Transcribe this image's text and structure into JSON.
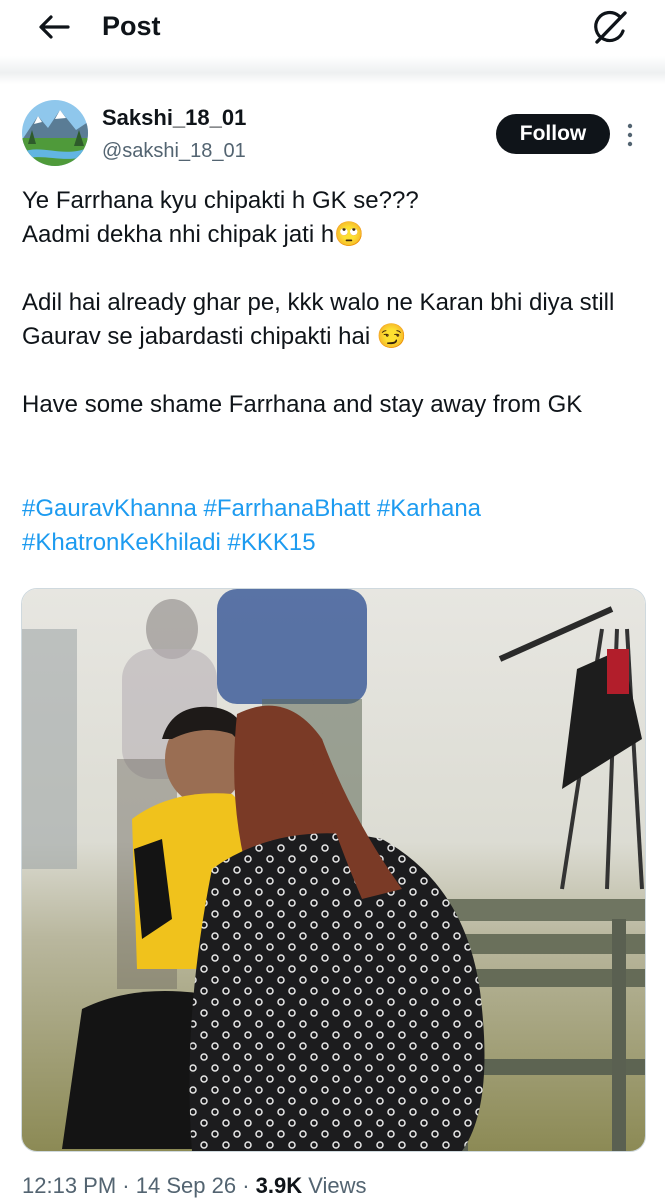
{
  "header": {
    "title": "Post",
    "back_icon": "back-arrow-icon",
    "grok_icon": "grok-icon"
  },
  "author": {
    "display_name": "Sakshi_18_01",
    "handle": "@sakshi_18_01",
    "follow_label": "Follow",
    "more_icon": "more-vertical-icon"
  },
  "tweet": {
    "lines": [
      "Ye Farrhana kyu chipakti h GK se???",
      "Aadmi dekha nhi chipak jati h🙄",
      "Adil hai already ghar pe,  kkk walo ne Karan bhi diya still Gaurav se jabardasti chipakti hai 😏",
      "Have some shame Farrhana and stay away from GK"
    ],
    "hashtags": [
      "#GauravKhanna",
      "#FarrhanaBhatt",
      "#Karhana",
      "#KhatronKeKhiladi",
      "#KKK15"
    ]
  },
  "meta": {
    "time": "12:13 PM",
    "date": "14 Sep 26",
    "views_count": "3.9K",
    "views_label": "Views"
  },
  "colors": {
    "accent": "#1d9bf0",
    "text": "#0f1419",
    "secondary": "#536471",
    "follow_bg": "#0f1419"
  }
}
